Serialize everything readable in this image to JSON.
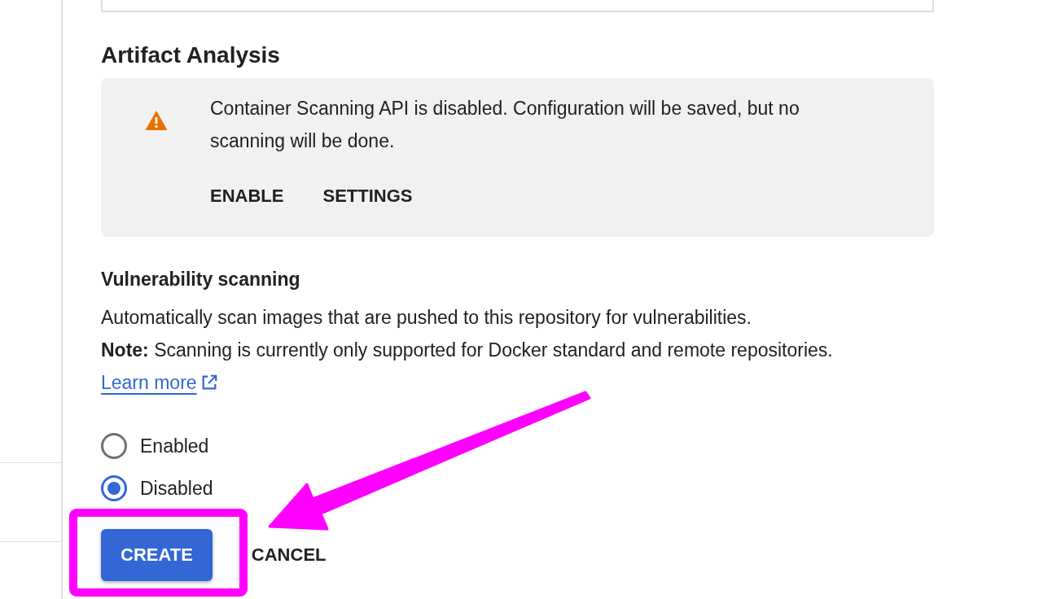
{
  "section": {
    "title": "Artifact Analysis"
  },
  "alert": {
    "kind": "warning",
    "message": "Container Scanning API is disabled. Configuration will be saved, but no scanning will be done.",
    "actions": [
      "ENABLE",
      "SETTINGS"
    ]
  },
  "vulnerability_scanning": {
    "title": "Vulnerability scanning",
    "description": "Automatically scan images that are pushed to this repository for vulnerabilities.",
    "note": "**Note:** Scanning is currently only supported for Docker standard and remote repositories.",
    "link": "Learn more",
    "options": [
      {
        "label": "Enabled",
        "selected": false
      },
      {
        "label": "Disabled",
        "selected": true
      }
    ]
  },
  "buttons": [
    {
      "label": "CREATE",
      "kind": "primary"
    },
    {
      "label": "CANCEL",
      "kind": "text"
    }
  ]
}
